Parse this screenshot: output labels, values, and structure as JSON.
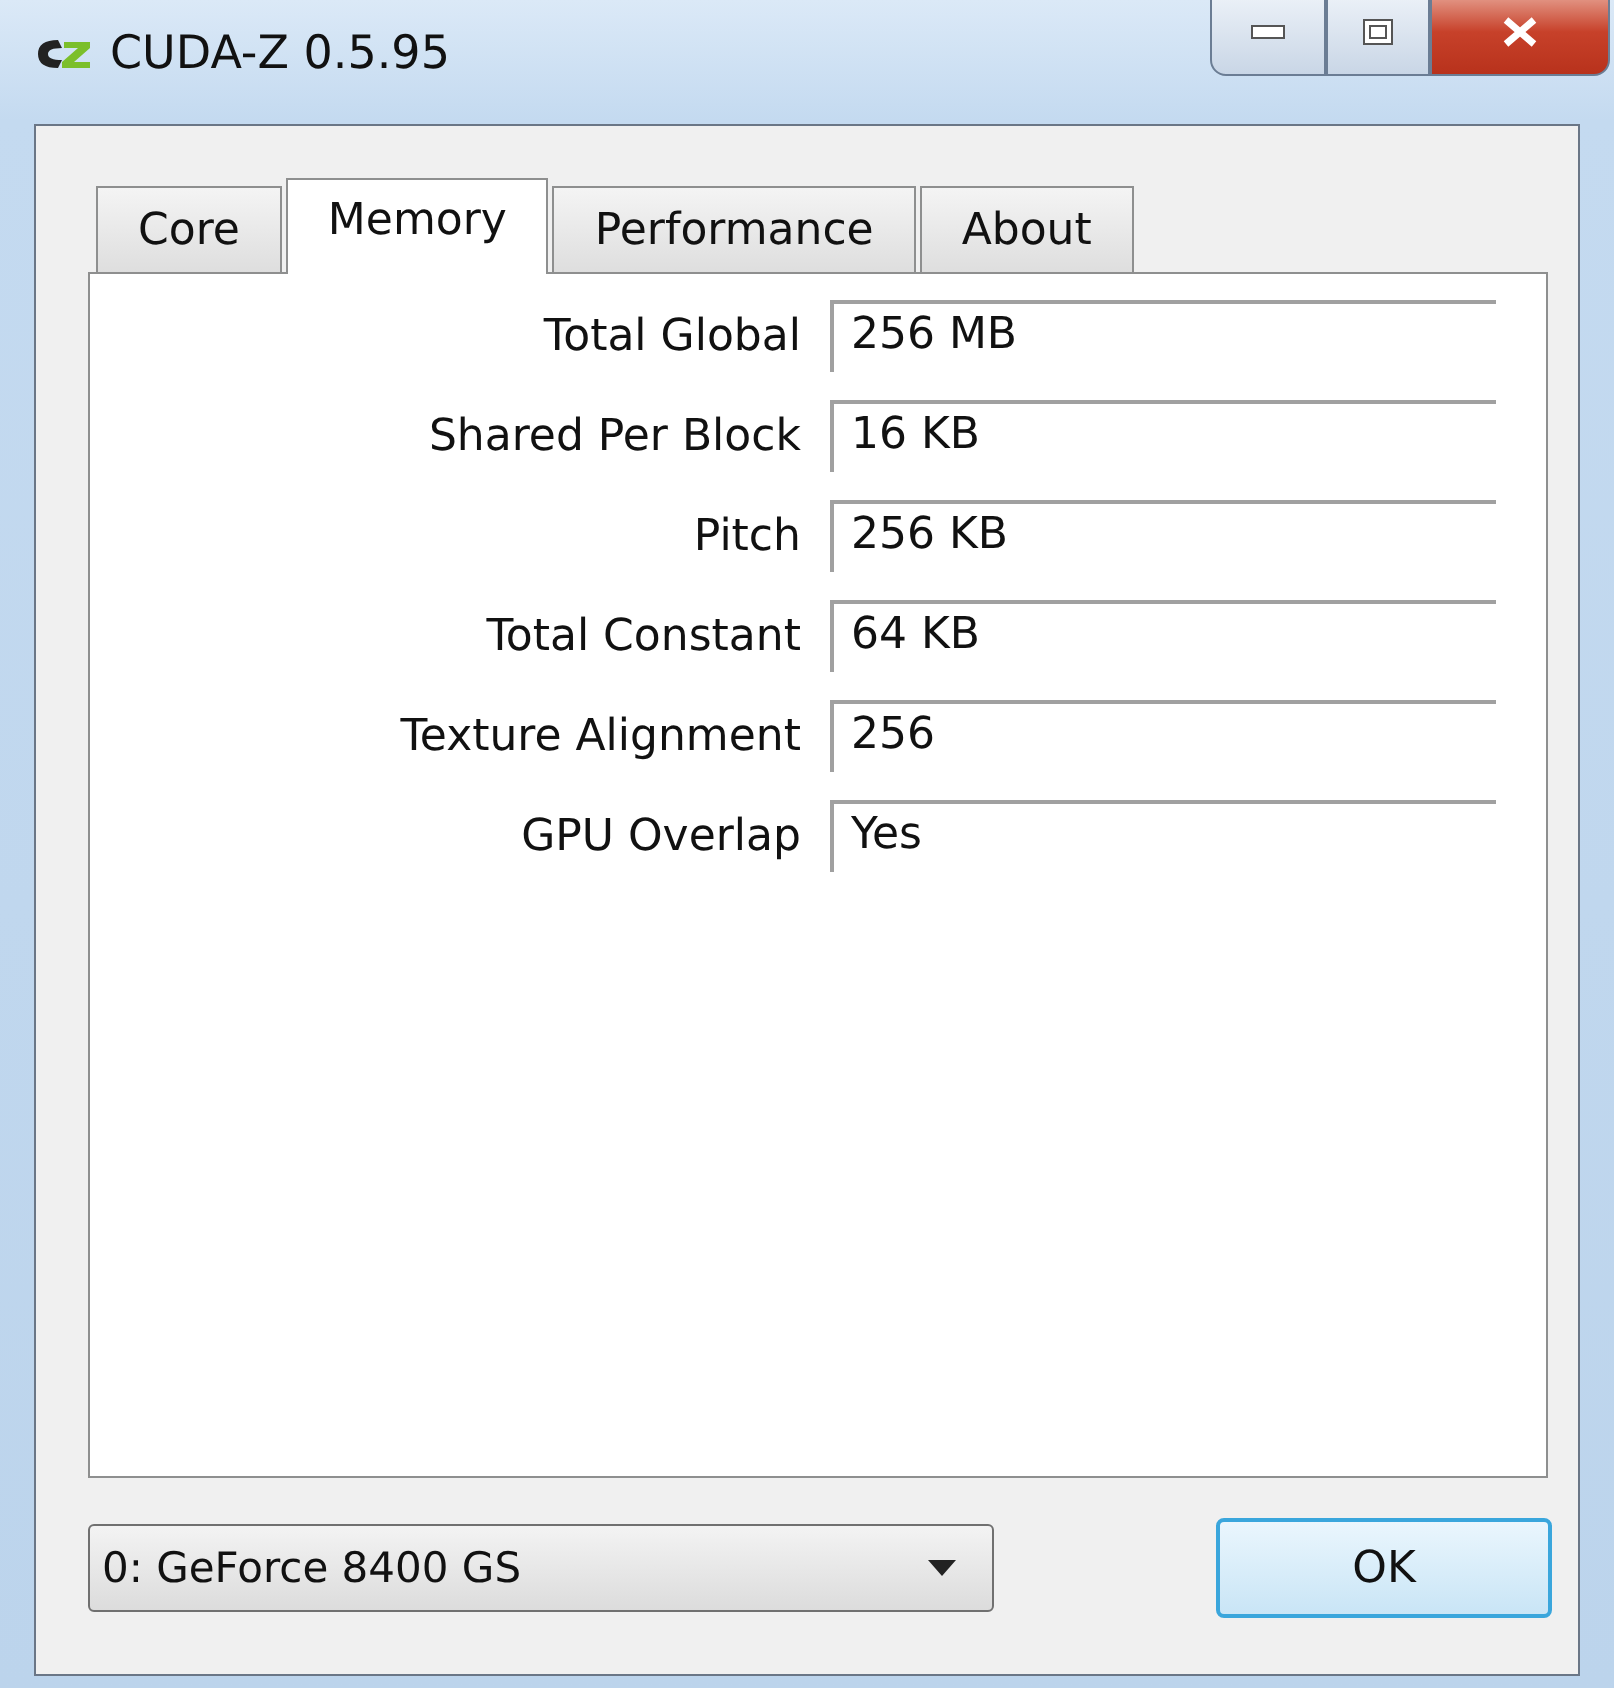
{
  "window": {
    "title": "CUDA-Z 0.5.95"
  },
  "tabs": [
    {
      "label": "Core",
      "selected": false
    },
    {
      "label": "Memory",
      "selected": true
    },
    {
      "label": "Performance",
      "selected": false
    },
    {
      "label": "About",
      "selected": false
    }
  ],
  "fields": [
    {
      "label": "Total Global",
      "value": "256 MB"
    },
    {
      "label": "Shared Per Block",
      "value": "16 KB"
    },
    {
      "label": "Pitch",
      "value": "256 KB"
    },
    {
      "label": "Total Constant",
      "value": "64 KB"
    },
    {
      "label": "Texture Alignment",
      "value": "256"
    },
    {
      "label": "GPU Overlap",
      "value": "Yes"
    }
  ],
  "device_select": {
    "value": "0: GeForce 8400 GS"
  },
  "buttons": [
    "OK"
  ]
}
